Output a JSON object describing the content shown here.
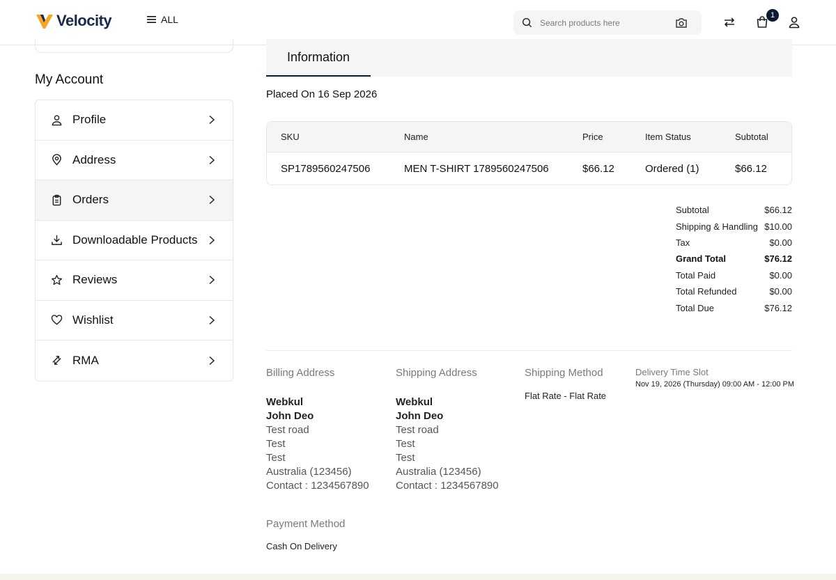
{
  "header": {
    "logo_text": "Velocity",
    "menu_label": "ALL",
    "search_placeholder": "Search products here",
    "cart_count": "1"
  },
  "sidebar": {
    "title": "My Account",
    "items": [
      {
        "label": "Profile",
        "icon": "user-icon"
      },
      {
        "label": "Address",
        "icon": "location-pin-icon"
      },
      {
        "label": "Orders",
        "icon": "clipboard-icon",
        "active": true
      },
      {
        "label": "Downloadable Products",
        "icon": "download-icon"
      },
      {
        "label": "Reviews",
        "icon": "star-icon"
      },
      {
        "label": "Wishlist",
        "icon": "heart-icon"
      },
      {
        "label": "RMA",
        "icon": "exchange-icon"
      }
    ]
  },
  "main": {
    "tab_label": "Information",
    "placed_on": "Placed On 16 Sep 2026",
    "table": {
      "headers": [
        "SKU",
        "Name",
        "Price",
        "Item Status",
        "Subtotal"
      ],
      "rows": [
        [
          "SP1789560247506",
          "MEN T-SHIRT 1789560247506",
          "$66.12",
          "Ordered (1)",
          "$66.12"
        ]
      ]
    },
    "summary": [
      {
        "label": "Subtotal",
        "value": "$66.12"
      },
      {
        "label": "Shipping & Handling",
        "value": "$10.00"
      },
      {
        "label": "Tax",
        "value": "$0.00"
      },
      {
        "label": "Grand Total",
        "value": "$76.12",
        "bold": true
      },
      {
        "label": "Total Paid",
        "value": "$0.00"
      },
      {
        "label": "Total Refunded",
        "value": "$0.00"
      },
      {
        "label": "Total Due",
        "value": "$76.12"
      }
    ],
    "billing": {
      "title": "Billing Address",
      "company": "Webkul",
      "name": "John Deo",
      "line1": "Test road",
      "line2": "Test",
      "line3": "Test",
      "country": "Australia (123456)",
      "contact": "Contact : 1234567890"
    },
    "shipping": {
      "title": "Shipping Address",
      "company": "Webkul",
      "name": "John Deo",
      "line1": "Test road",
      "line2": "Test",
      "line3": "Test",
      "country": "Australia (123456)",
      "contact": "Contact : 1234567890"
    },
    "shipping_method": {
      "title": "Shipping Method",
      "value": "Flat Rate - Flat Rate"
    },
    "delivery_slot": {
      "title": "Delivery Time Slot",
      "value": "Nov 19, 2026 (Thursday) 09:00 AM - 12:00 PM"
    },
    "payment": {
      "title": "Payment Method",
      "value": "Cash On Delivery"
    }
  },
  "colors": {
    "accent_dark": "#0a1a33",
    "logo_orange": "#f5a623",
    "logo_blue": "#1a2a4a",
    "panel_bg": "#f5f5f5",
    "footer_bg": "#f7f4ee"
  }
}
